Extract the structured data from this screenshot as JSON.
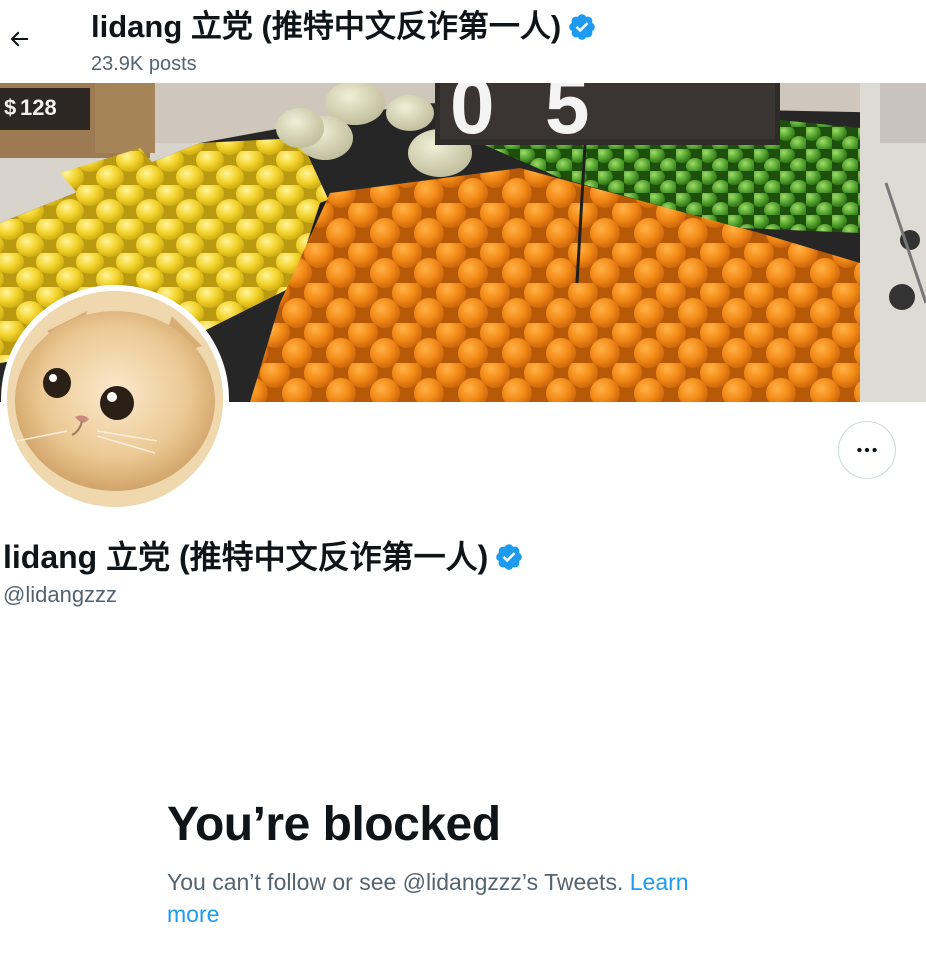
{
  "header": {
    "display_name": "lidang 立党 (推特中文反诈第一人)",
    "posts_count": "23.9K posts"
  },
  "profile": {
    "display_name": "lidang 立党 (推特中文反诈第一人)",
    "handle": "@lidangzzz",
    "verified": true
  },
  "banner": {
    "price_sign_left": "128"
  },
  "blocked": {
    "title": "You’re blocked",
    "description": "You can’t follow or see @lidangzzz’s Tweets.",
    "learn_more_label": "Learn more"
  },
  "colors": {
    "accent": "#1d9bf0",
    "text_primary": "#0f1419",
    "text_secondary": "#536471",
    "border": "#cfd9de"
  },
  "icons": {
    "back": "arrow-left-icon",
    "more": "more-dots-icon",
    "verified": "verified-badge-icon"
  }
}
